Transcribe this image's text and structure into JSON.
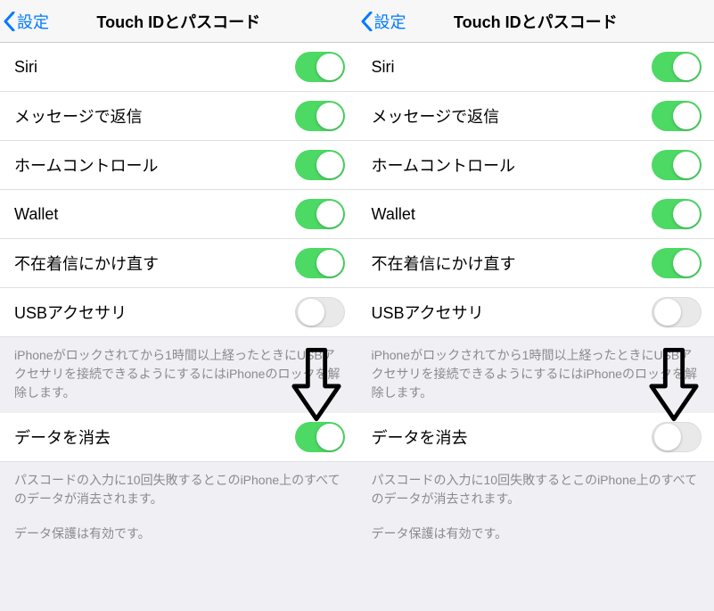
{
  "header": {
    "back_label": "設定",
    "title": "Touch IDとパスコード"
  },
  "rows": {
    "siri": "Siri",
    "reply_message": "メッセージで返信",
    "home_control": "ホームコントロール",
    "wallet": "Wallet",
    "callback_missed": "不在着信にかけ直す",
    "usb_accessories": "USBアクセサリ",
    "erase_data": "データを消去"
  },
  "notes": {
    "usb": "iPhoneがロックされてから1時間以上経ったときにUSBアクセサリを接続できるようにするにはiPhoneのロックを解除します。",
    "erase": "パスコードの入力に10回失敗するとこのiPhone上のすべてのデータが消去されます。",
    "data_protection": "データ保護は有効です。"
  },
  "left_panel": {
    "siri": true,
    "reply_message": true,
    "home_control": true,
    "wallet": true,
    "callback_missed": true,
    "usb_accessories": false,
    "erase_data": true
  },
  "right_panel": {
    "siri": true,
    "reply_message": true,
    "home_control": true,
    "wallet": true,
    "callback_missed": true,
    "usb_accessories": false,
    "erase_data": false
  }
}
